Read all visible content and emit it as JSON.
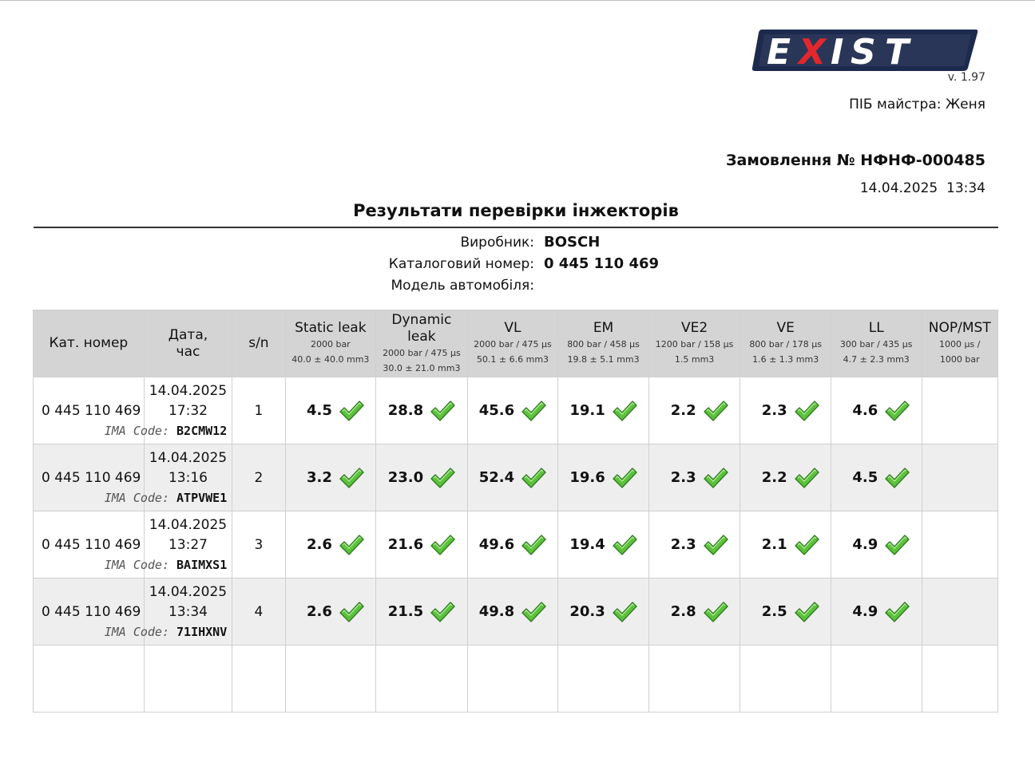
{
  "logo_text": "EXIST",
  "version": "v. 1.97",
  "master_label": "ПІБ майстра:",
  "master_name": "Женя",
  "order_title": "Замовлення № НФНФ-000485",
  "order_datetime": "14.04.2025  13:34",
  "page_title": "Результати перевірки інжекторів",
  "info": [
    {
      "label": "Виробник:",
      "value": "BOSCH"
    },
    {
      "label": "Каталоговий номер:",
      "value": "0 445 110 469"
    },
    {
      "label": "Модель автомобіля:",
      "value": ""
    }
  ],
  "columns": [
    {
      "title": "Кат. номер",
      "sub": []
    },
    {
      "title": "Дата,\nчас",
      "sub": []
    },
    {
      "title": "s/n",
      "sub": []
    },
    {
      "title": "Static leak",
      "sub": [
        "2000 bar",
        "40.0 ± 40.0 mm3"
      ]
    },
    {
      "title": "Dynamic leak",
      "sub": [
        "2000 bar / 475 μs",
        "30.0 ± 21.0 mm3"
      ]
    },
    {
      "title": "VL",
      "sub": [
        "2000 bar / 475 μs",
        "50.1 ± 6.6 mm3"
      ]
    },
    {
      "title": "EM",
      "sub": [
        "800 bar / 458 μs",
        "19.8 ± 5.1 mm3"
      ]
    },
    {
      "title": "VE2",
      "sub": [
        "1200 bar / 158 μs",
        "1.5 mm3"
      ]
    },
    {
      "title": "VE",
      "sub": [
        "800 bar / 178 μs",
        "1.6 ± 1.3 mm3"
      ]
    },
    {
      "title": "LL",
      "sub": [
        "300 bar / 435 μs",
        "4.7 ± 2.3 mm3"
      ]
    },
    {
      "title": "NOP/MST",
      "sub": [
        "1000 μs /",
        "1000 bar"
      ]
    }
  ],
  "ima_label": "IMA Code:",
  "rows": [
    {
      "kat": "0 445 110 469",
      "date": "14.04.2025",
      "time": "17:32",
      "ima": "B2CMW12",
      "sn": "1",
      "values": [
        "4.5",
        "28.8",
        "45.6",
        "19.1",
        "2.2",
        "2.3",
        "4.6"
      ],
      "nop": ""
    },
    {
      "kat": "0 445 110 469",
      "date": "14.04.2025",
      "time": "13:16",
      "ima": "ATPVWE1",
      "sn": "2",
      "values": [
        "3.2",
        "23.0",
        "52.4",
        "19.6",
        "2.3",
        "2.2",
        "4.5"
      ],
      "nop": ""
    },
    {
      "kat": "0 445 110 469",
      "date": "14.04.2025",
      "time": "13:27",
      "ima": "BAIMXS1",
      "sn": "3",
      "values": [
        "2.6",
        "21.6",
        "49.6",
        "19.4",
        "2.3",
        "2.1",
        "4.9"
      ],
      "nop": ""
    },
    {
      "kat": "0 445 110 469",
      "date": "14.04.2025",
      "time": "13:34",
      "ima": "71IHXNV",
      "sn": "4",
      "values": [
        "2.6",
        "21.5",
        "49.8",
        "20.3",
        "2.8",
        "2.5",
        "4.9"
      ],
      "nop": ""
    }
  ],
  "status_icon": "checkmark-pass-icon",
  "colors": {
    "header_bg": "#d4d4d4",
    "row_alt_bg": "#eeeeee",
    "check_green": "#5cc23c",
    "logo_navy": "#1c2a4e",
    "logo_red": "#e3272d"
  }
}
